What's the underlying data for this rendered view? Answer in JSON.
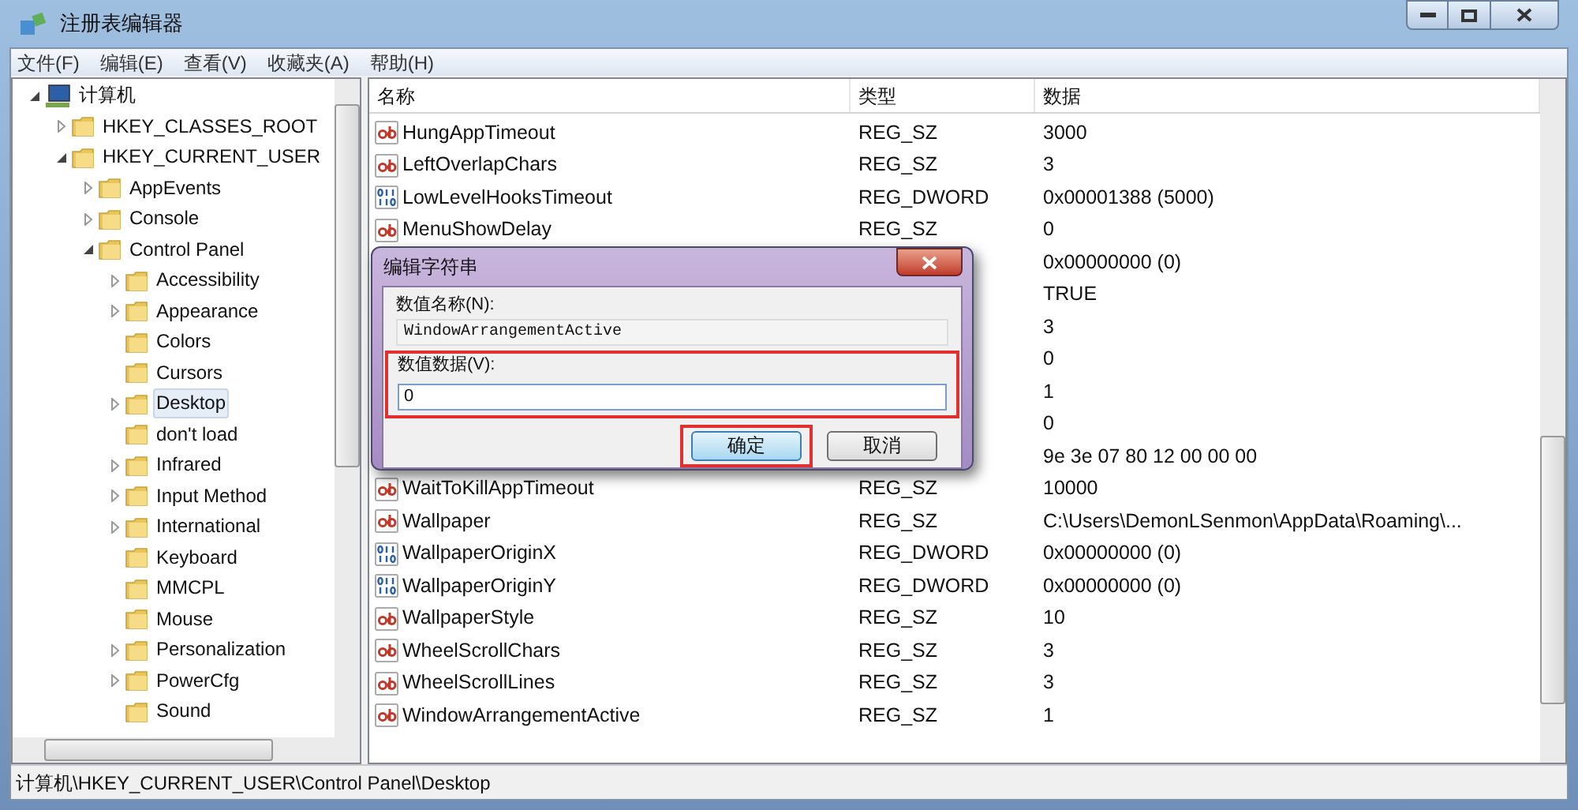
{
  "window": {
    "title": "注册表编辑器"
  },
  "menu": [
    "文件(F)",
    "编辑(E)",
    "查看(V)",
    "收藏夹(A)",
    "帮助(H)"
  ],
  "tree": [
    {
      "label": "计算机",
      "kind": "computer",
      "expanded": true,
      "selected": false,
      "children": [
        {
          "label": "HKEY_CLASSES_ROOT",
          "kind": "folder",
          "expanded": false,
          "selected": false
        },
        {
          "label": "HKEY_CURRENT_USER",
          "kind": "folder",
          "expanded": true,
          "selected": false,
          "children": [
            {
              "label": "AppEvents",
              "kind": "folder",
              "expanded": false,
              "selected": false
            },
            {
              "label": "Console",
              "kind": "folder",
              "expanded": false,
              "selected": false
            },
            {
              "label": "Control Panel",
              "kind": "folder",
              "expanded": true,
              "selected": false,
              "children": [
                {
                  "label": "Accessibility",
                  "kind": "folder",
                  "expanded": false,
                  "selected": false
                },
                {
                  "label": "Appearance",
                  "kind": "folder",
                  "expanded": false,
                  "selected": false
                },
                {
                  "label": "Colors",
                  "kind": "folder",
                  "selected": false
                },
                {
                  "label": "Cursors",
                  "kind": "folder",
                  "selected": false
                },
                {
                  "label": "Desktop",
                  "kind": "folder",
                  "expanded": false,
                  "selected": true
                },
                {
                  "label": "don't load",
                  "kind": "folder",
                  "selected": false
                },
                {
                  "label": "Infrared",
                  "kind": "folder",
                  "expanded": false,
                  "selected": false
                },
                {
                  "label": "Input Method",
                  "kind": "folder",
                  "expanded": false,
                  "selected": false
                },
                {
                  "label": "International",
                  "kind": "folder",
                  "expanded": false,
                  "selected": false
                },
                {
                  "label": "Keyboard",
                  "kind": "folder",
                  "selected": false
                },
                {
                  "label": "MMCPL",
                  "kind": "folder",
                  "selected": false
                },
                {
                  "label": "Mouse",
                  "kind": "folder",
                  "selected": false
                },
                {
                  "label": "Personalization",
                  "kind": "folder",
                  "expanded": false,
                  "selected": false
                },
                {
                  "label": "PowerCfg",
                  "kind": "folder",
                  "expanded": false,
                  "selected": false
                },
                {
                  "label": "Sound",
                  "kind": "folder",
                  "selected": false
                }
              ]
            }
          ]
        }
      ]
    }
  ],
  "table": {
    "columns": [
      "名称",
      "类型",
      "数据"
    ],
    "rows": [
      {
        "kind": "string",
        "name": "HungAppTimeout",
        "type": "REG_SZ",
        "data": "3000"
      },
      {
        "kind": "string",
        "name": "LeftOverlapChars",
        "type": "REG_SZ",
        "data": "3"
      },
      {
        "kind": "dword",
        "name": "LowLevelHooksTimeout",
        "type": "REG_DWORD",
        "data": "0x00001388 (5000)"
      },
      {
        "kind": "string",
        "name": "MenuShowDelay",
        "type": "REG_SZ",
        "data": "0"
      },
      {
        "kind": "hidden",
        "data": "0x00000000 (0)"
      },
      {
        "kind": "hidden",
        "data": "TRUE"
      },
      {
        "kind": "hidden",
        "data": "3"
      },
      {
        "kind": "hidden",
        "data": "0"
      },
      {
        "kind": "hidden",
        "data": "1"
      },
      {
        "kind": "hidden",
        "data": "0"
      },
      {
        "kind": "hidden",
        "data": "9e 3e 07 80 12 00 00 00"
      },
      {
        "kind": "string",
        "name": "WaitToKillAppTimeout",
        "type": "REG_SZ",
        "data": "10000"
      },
      {
        "kind": "string",
        "name": "Wallpaper",
        "type": "REG_SZ",
        "data": "C:\\Users\\DemonLSenmon\\AppData\\Roaming\\..."
      },
      {
        "kind": "dword",
        "name": "WallpaperOriginX",
        "type": "REG_DWORD",
        "data": "0x00000000 (0)"
      },
      {
        "kind": "dword",
        "name": "WallpaperOriginY",
        "type": "REG_DWORD",
        "data": "0x00000000 (0)"
      },
      {
        "kind": "string",
        "name": "WallpaperStyle",
        "type": "REG_SZ",
        "data": "10"
      },
      {
        "kind": "string",
        "name": "WheelScrollChars",
        "type": "REG_SZ",
        "data": "3"
      },
      {
        "kind": "string",
        "name": "WheelScrollLines",
        "type": "REG_SZ",
        "data": "3"
      },
      {
        "kind": "string",
        "name": "WindowArrangementActive",
        "type": "REG_SZ",
        "data": "1"
      }
    ]
  },
  "dialog": {
    "title": "编辑字符串",
    "name_label": "数值名称(N):",
    "name_value": "WindowArrangementActive",
    "data_label": "数值数据(V):",
    "data_value": "0",
    "data_highlighted": true,
    "buttons": [
      {
        "label": "确定",
        "default": true,
        "highlighted": true
      },
      {
        "label": "取消",
        "default": false,
        "highlighted": false
      }
    ]
  },
  "status_bar": "计算机\\HKEY_CURRENT_USER\\Control Panel\\Desktop"
}
